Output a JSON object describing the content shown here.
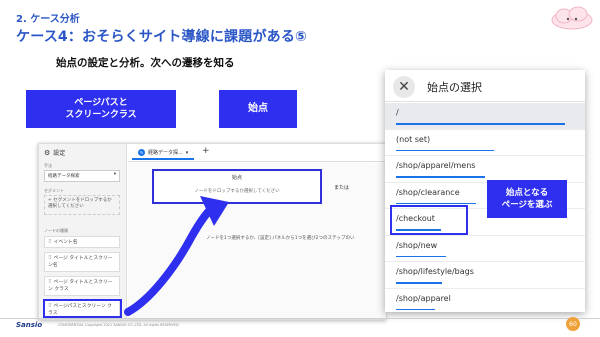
{
  "slide": {
    "section": "2. ケース分析",
    "title": "ケース4：おそらくサイト導線に課題がある⑤",
    "subtitle": "始点の設定と分析。次への遷移を知る",
    "label_path": "ページパスと\nスクリーンクラス",
    "label_start": "始点",
    "callout": "始点となる\nページを選ぶ",
    "logo": "Sansio",
    "copyright": "CONFIDENTIAL Copyright 2021 SANSIO CO.,LTD. All rights RESERVED",
    "page_number": "60"
  },
  "screenshot": {
    "sidebar": {
      "title": "設定",
      "technique_label": "手法",
      "technique_value": "経路データ探索",
      "segment_label": "セグメント",
      "segment_drop": "セグメントをドロップするか選択してください",
      "node_label": "ノードの種類",
      "nodes": [
        "イベント名",
        "ページ タイトルとスクリーン名",
        "ページ タイトルとスクリーン クラス",
        "ページパスとスクリーン クラス"
      ]
    },
    "tab_label": "経路データ探...",
    "start_label": "始点",
    "start_placeholder": "ノードをドロップするか選択してください",
    "or_label": "または",
    "instruction": "ノードを1つ選択するか、[設定] パネルから1つを選び2つのステップのい"
  },
  "panel": {
    "title": "始点の選択",
    "items": [
      {
        "label": "/",
        "bar": 0.95
      },
      {
        "label": "(not set)",
        "bar": 0.55
      },
      {
        "label": "/shop/apparel/mens",
        "bar": 0.5
      },
      {
        "label": "/shop/clearance",
        "bar": 0.45
      },
      {
        "label": "/checkout",
        "bar": 0.25
      },
      {
        "label": "/shop/new",
        "bar": 0.28
      },
      {
        "label": "/shop/lifestyle/bags",
        "bar": 0.26
      },
      {
        "label": "/shop/apparel",
        "bar": 0.22
      }
    ]
  },
  "colors": {
    "accent": "#2f2ff0",
    "title": "#2a56c6",
    "bar": "#1a73e8"
  }
}
